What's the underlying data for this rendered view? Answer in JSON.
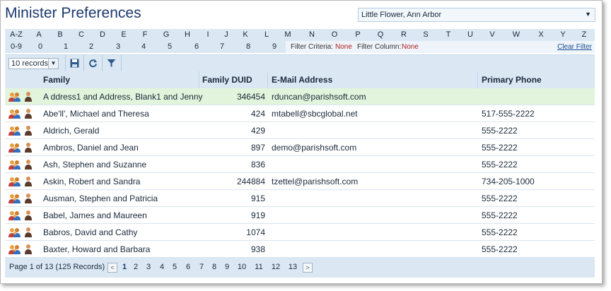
{
  "page": {
    "title": "Minister Preferences"
  },
  "parish_select": {
    "value": "Little Flower, Ann Arbor"
  },
  "alpha_filter": {
    "letters": [
      "A-Z",
      "A",
      "B",
      "C",
      "D",
      "E",
      "F",
      "G",
      "H",
      "I",
      "J",
      "K",
      "L",
      "M",
      "N",
      "O",
      "P",
      "Q",
      "R",
      "S",
      "T",
      "U",
      "V",
      "W",
      "X",
      "Y",
      "Z"
    ],
    "digits": [
      "0-9",
      "0",
      "1",
      "2",
      "3",
      "4",
      "5",
      "6",
      "7",
      "8",
      "9"
    ]
  },
  "filter": {
    "criteria_label": "Filter Criteria:",
    "criteria_value": "None",
    "column_label": "Filter Column:",
    "column_value": "None",
    "clear_label": "Clear Filter"
  },
  "toolbar": {
    "records_value": "10 records",
    "icons": [
      "save-icon",
      "refresh-icon",
      "filter-icon"
    ]
  },
  "table": {
    "columns": [
      "Family",
      "Family DUID",
      "E-Mail Address",
      "Primary Phone"
    ],
    "rows": [
      {
        "family": "A ddress1 and Address, Blank1 and Jenny",
        "duid": "346454",
        "email": "rduncan@parishsoft.com",
        "phone": ""
      },
      {
        "family": "Abe'll', Michael and Theresa",
        "duid": "424",
        "email": "mtabell@sbcglobal.net",
        "phone": "517-555-2222"
      },
      {
        "family": "Aldrich, Gerald",
        "duid": "429",
        "email": "",
        "phone": "555-2222"
      },
      {
        "family": "Ambros, Daniel and Jean",
        "duid": "897",
        "email": "demo@parishsoft.com",
        "phone": "555-2222"
      },
      {
        "family": "Ash, Stephen and Suzanne",
        "duid": "836",
        "email": "",
        "phone": "555-2222"
      },
      {
        "family": "Askin, Robert and Sandra",
        "duid": "244884",
        "email": "tzettel@parishsoft.com",
        "phone": "734-205-1000"
      },
      {
        "family": "Ausman, Stephen and Patricia",
        "duid": "915",
        "email": "",
        "phone": "555-2222"
      },
      {
        "family": "Babel, James and Maureen",
        "duid": "919",
        "email": "",
        "phone": "555-2222"
      },
      {
        "family": "Babros, David and Cathy",
        "duid": "1074",
        "email": "",
        "phone": "555-2222"
      },
      {
        "family": "Baxter, Howard and Barbara",
        "duid": "938",
        "email": "",
        "phone": "555-2222"
      }
    ],
    "selected_row": 0
  },
  "pager": {
    "info": "Page 1 of 13 (125 Records)",
    "pages": [
      "1",
      "2",
      "3",
      "4",
      "5",
      "6",
      "7",
      "8",
      "9",
      "10",
      "11",
      "12",
      "13"
    ],
    "current": "1"
  }
}
